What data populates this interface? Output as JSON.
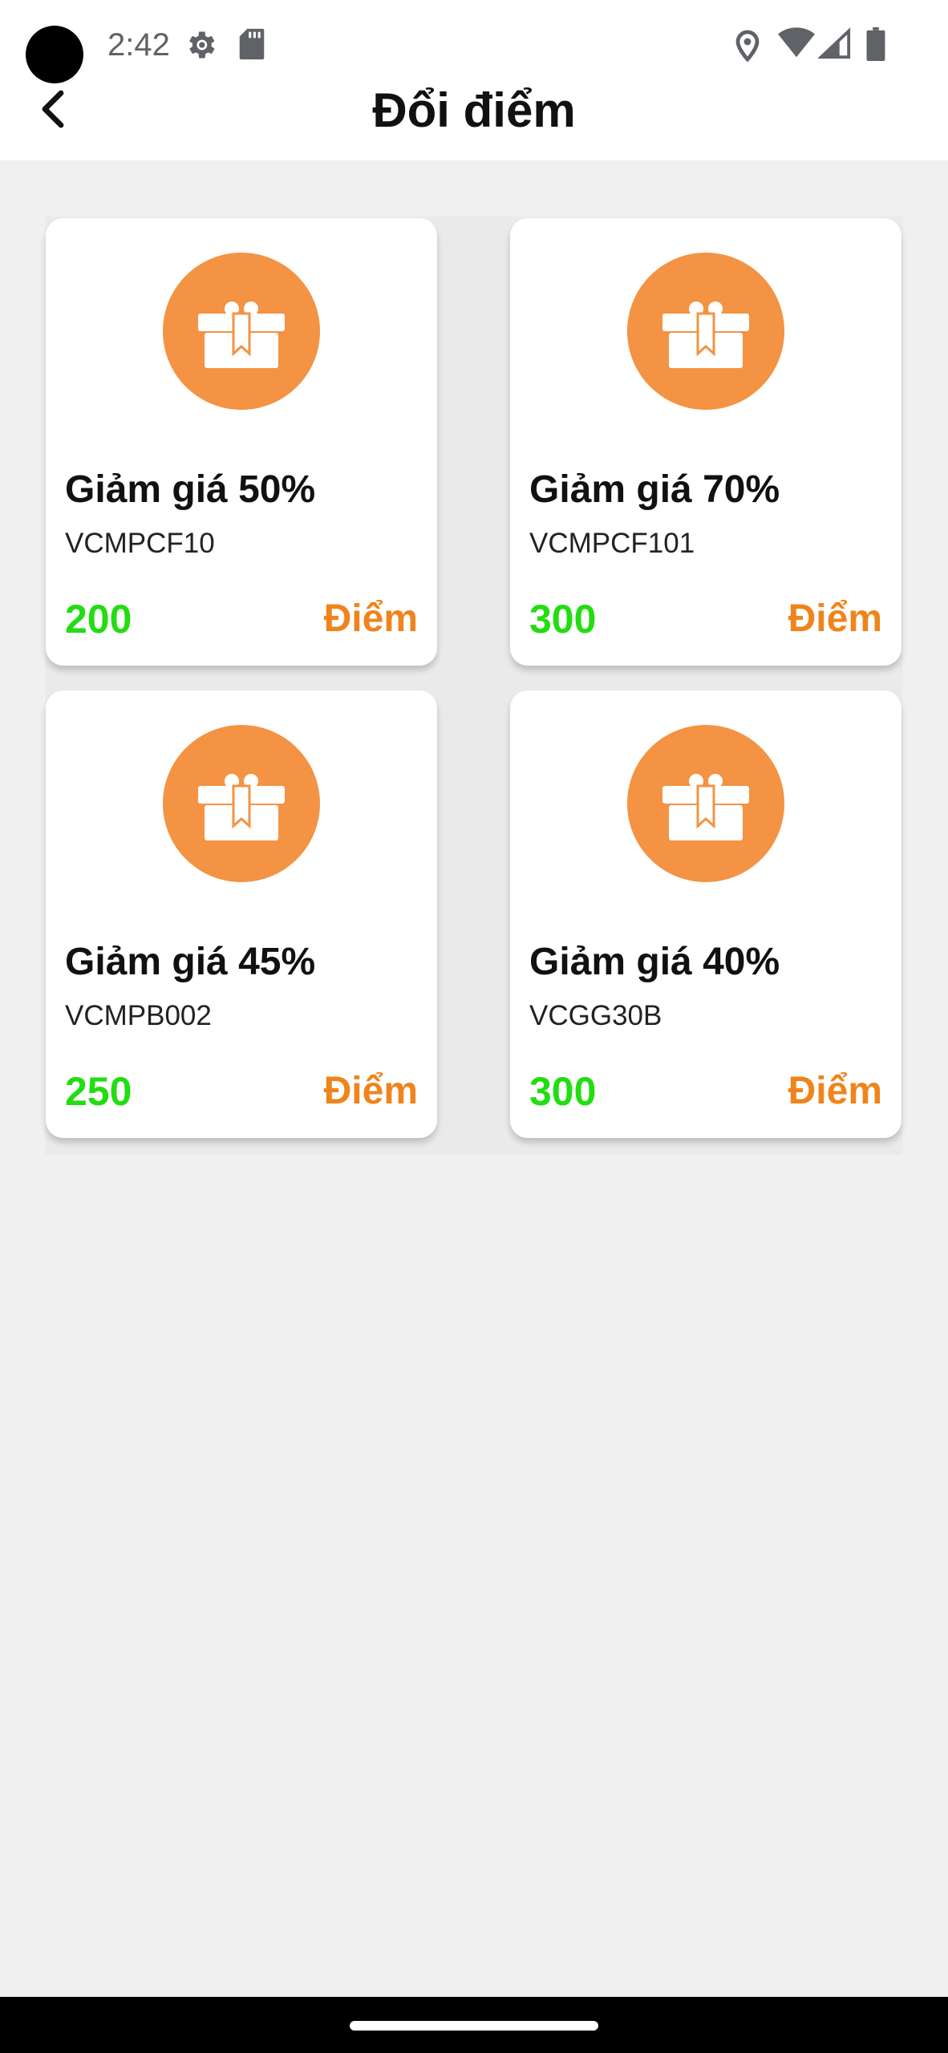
{
  "status_bar": {
    "time": "2:42",
    "icons": [
      "gear-icon",
      "sd-card-icon",
      "location-icon",
      "wifi-icon",
      "signal-icon",
      "battery-icon"
    ]
  },
  "header": {
    "title": "Đổi điểm",
    "back_icon": "chevron-left-icon"
  },
  "colors": {
    "accent_orange": "#f39343",
    "points_green": "#22dd11",
    "unit_orange": "#f0841c",
    "background": "#f0f0f0"
  },
  "vouchers": [
    {
      "title": "Giảm giá 50%",
      "code": "VCMPCF10",
      "points": "200",
      "unit": "Điểm",
      "icon": "gift-icon"
    },
    {
      "title": "Giảm giá 70%",
      "code": "VCMPCF101",
      "points": "300",
      "unit": "Điểm",
      "icon": "gift-icon"
    },
    {
      "title": "Giảm giá 45%",
      "code": "VCMPB002",
      "points": "250",
      "unit": "Điểm",
      "icon": "gift-icon"
    },
    {
      "title": "Giảm giá 40%",
      "code": "VCGG30B",
      "points": "300",
      "unit": "Điểm",
      "icon": "gift-icon"
    }
  ]
}
